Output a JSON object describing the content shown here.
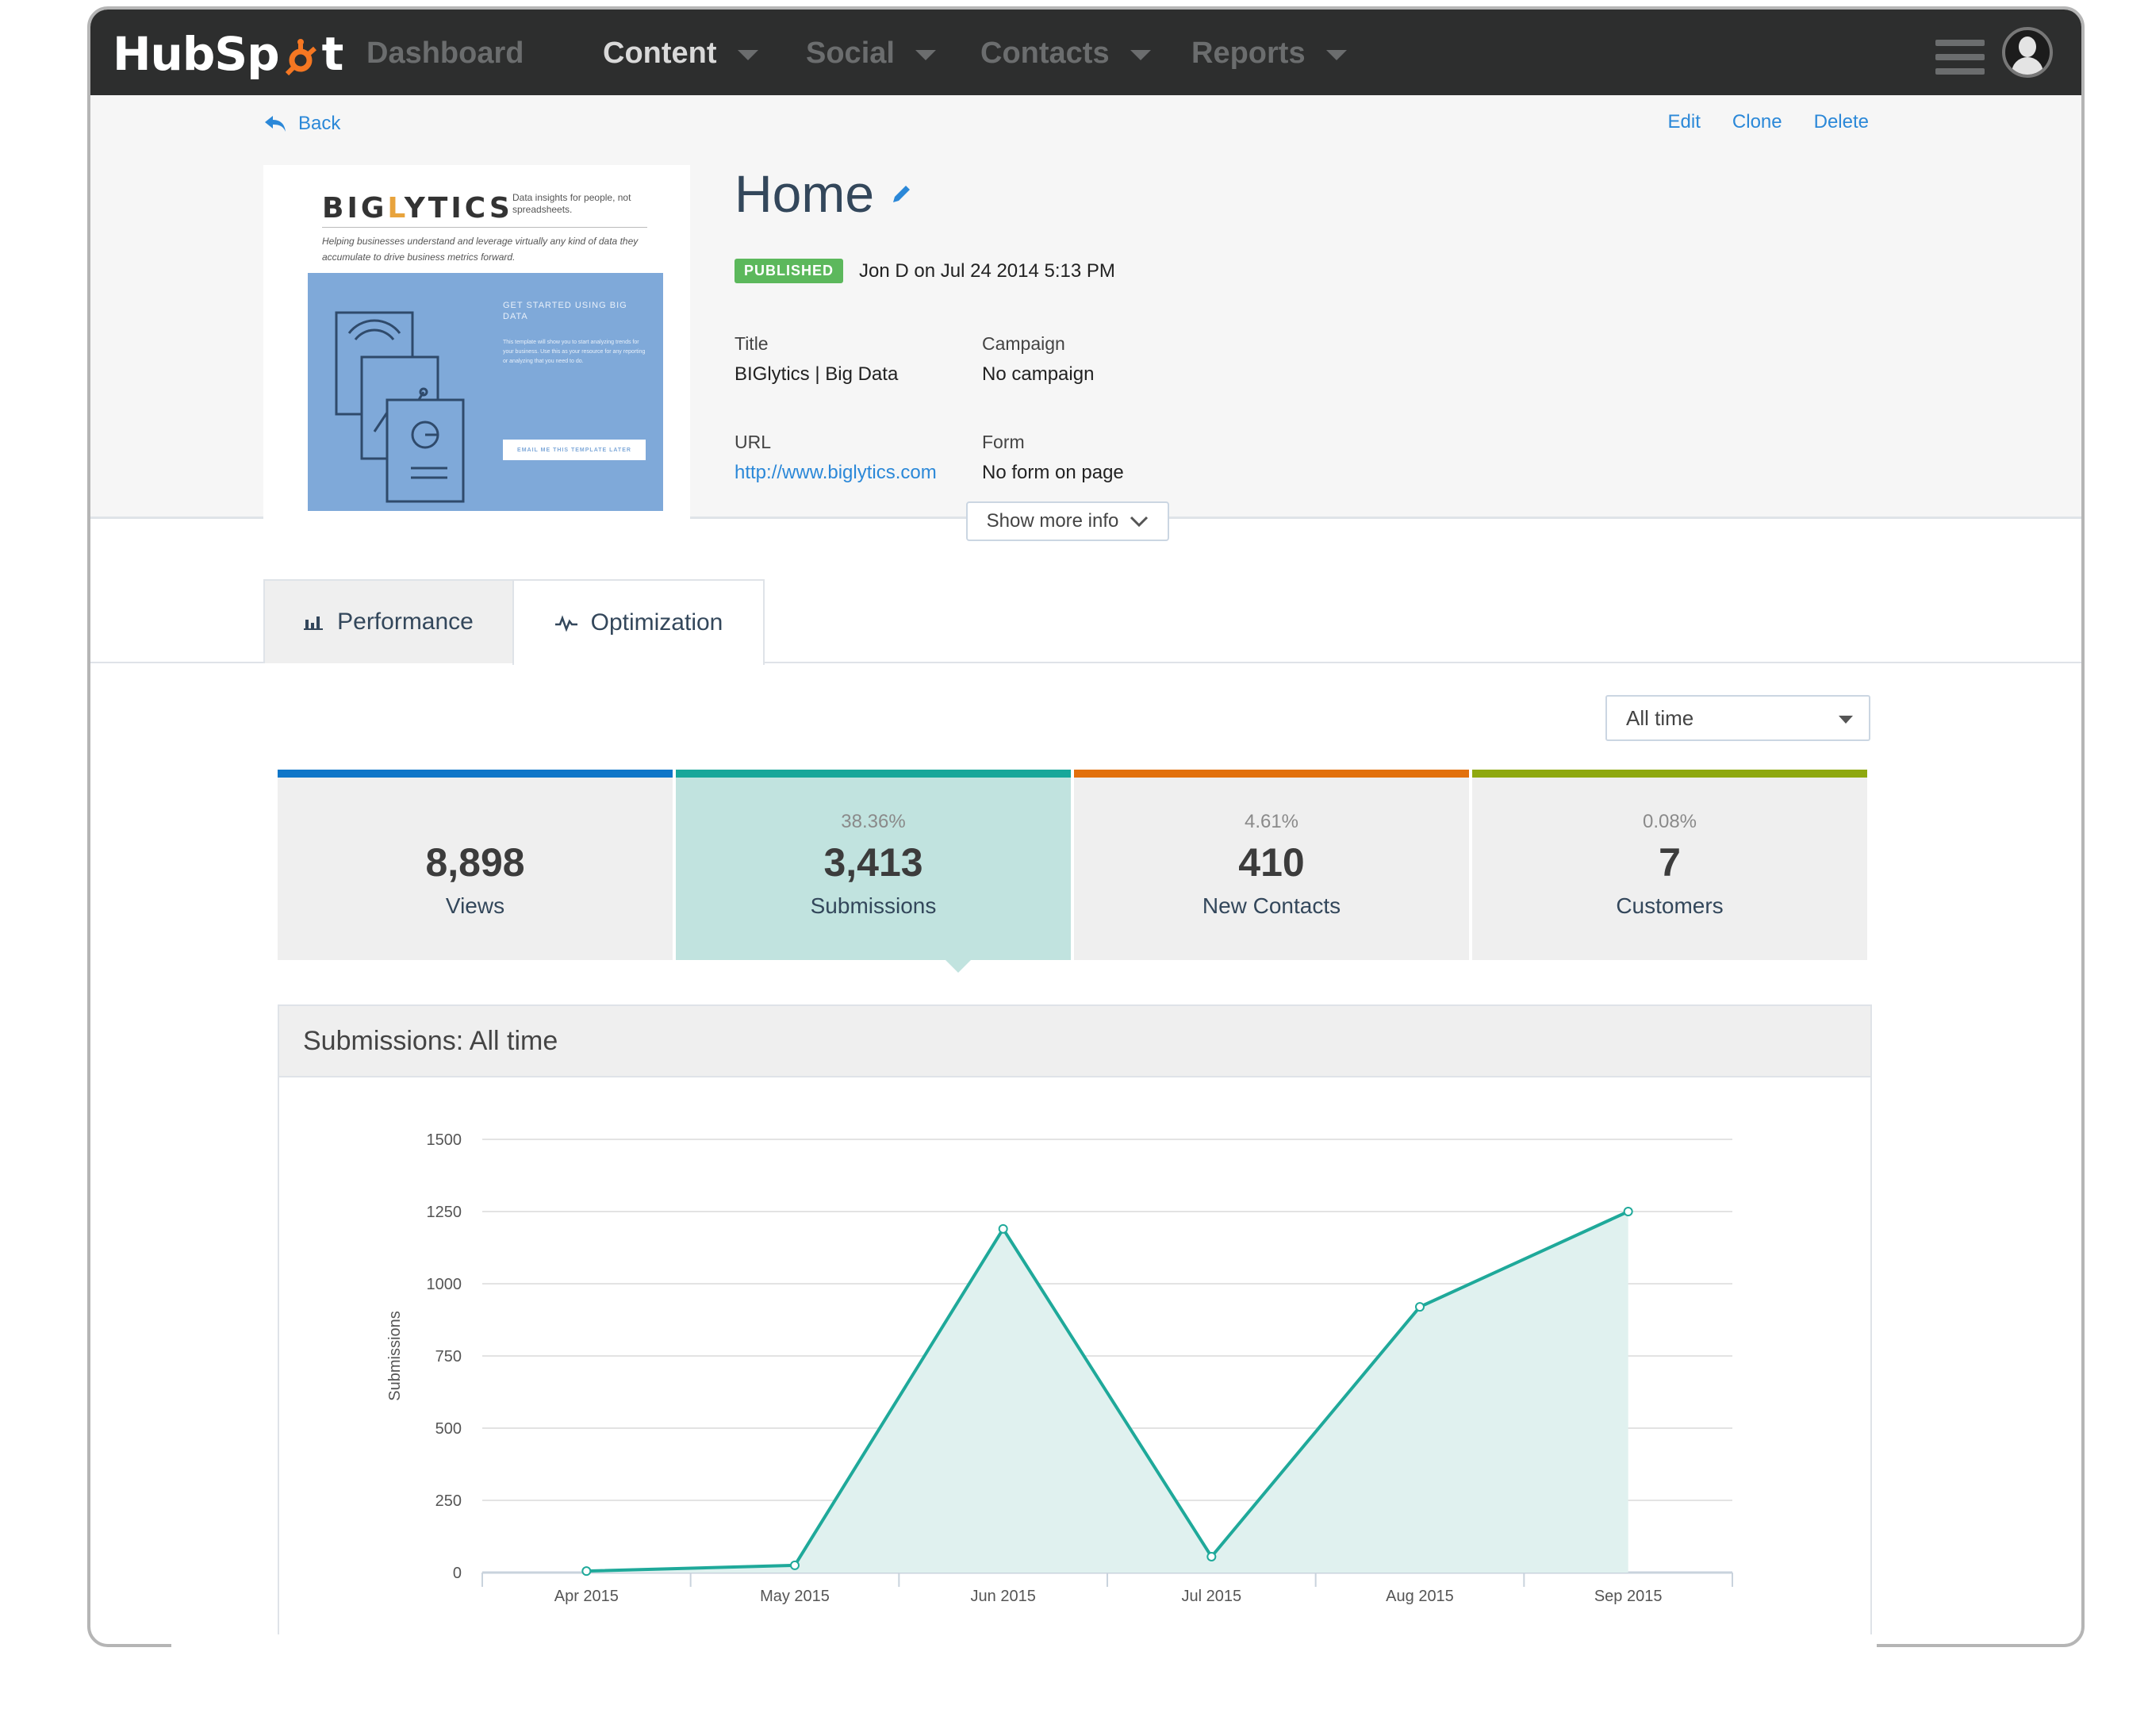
{
  "nav": {
    "logo": "HubSpot",
    "items": [
      {
        "label": "Dashboard",
        "active": false,
        "dropdown": false
      },
      {
        "label": "Content",
        "active": true,
        "dropdown": true
      },
      {
        "label": "Social",
        "active": false,
        "dropdown": true
      },
      {
        "label": "Contacts",
        "active": false,
        "dropdown": true
      },
      {
        "label": "Reports",
        "active": false,
        "dropdown": true
      }
    ]
  },
  "header": {
    "back_label": "Back",
    "actions": [
      "Edit",
      "Clone",
      "Delete"
    ],
    "page_title": "Home",
    "status_badge": "PUBLISHED",
    "status_text": "Jon D on Jul 24 2014 5:13 PM",
    "meta": {
      "title_label": "Title",
      "title_value": "BIGlytics | Big Data",
      "campaign_label": "Campaign",
      "campaign_value": "No campaign",
      "url_label": "URL",
      "url_value": "http://www.biglytics.com",
      "form_label": "Form",
      "form_value": "No form on page"
    },
    "show_more": "Show more info"
  },
  "thumbnail": {
    "brand": "BIGLYTICS",
    "tagline": "Data insights for people, not spreadsheets.",
    "subtag": "Helping businesses understand and leverage virtually any kind of data they accumulate to drive business metrics forward.",
    "cta_title": "GET STARTED USING BIG DATA",
    "cta_text": "This template will show you to start analyzing trends for your business. Use this as your resource for any reporting or analyzing that you need to do.",
    "cta_button": "EMAIL ME THIS TEMPLATE LATER"
  },
  "tabs": [
    {
      "label": "Performance",
      "icon": "bar-chart-icon",
      "active": false
    },
    {
      "label": "Optimization",
      "icon": "pulse-icon",
      "active": true
    }
  ],
  "time_filter": {
    "selected": "All time"
  },
  "stats": [
    {
      "pct": "",
      "value": "8,898",
      "label": "Views",
      "color": "#0f76c8",
      "selected": false
    },
    {
      "pct": "38.36%",
      "value": "3,413",
      "label": "Submissions",
      "color": "#17a79a",
      "selected": true
    },
    {
      "pct": "4.61%",
      "value": "410",
      "label": "New Contacts",
      "color": "#e2700c",
      "selected": false
    },
    {
      "pct": "0.08%",
      "value": "7",
      "label": "Customers",
      "color": "#8ea80f",
      "selected": false
    }
  ],
  "chart_panel": {
    "title": "Submissions: All time"
  },
  "chart_data": {
    "type": "area",
    "categories": [
      "Apr 2015",
      "May 2015",
      "Jun 2015",
      "Jul 2015",
      "Aug 2015",
      "Sep 2015"
    ],
    "series": [
      {
        "values": [
          5,
          25,
          1190,
          55,
          920,
          1250
        ]
      }
    ],
    "ylabel": "Submissions",
    "yticks": [
      0,
      250,
      500,
      750,
      1000,
      1250,
      1500
    ],
    "ylim": [
      0,
      1500
    ],
    "grid": true,
    "line_color": "#1fa99a",
    "fill_color": "#e0f1ef"
  }
}
